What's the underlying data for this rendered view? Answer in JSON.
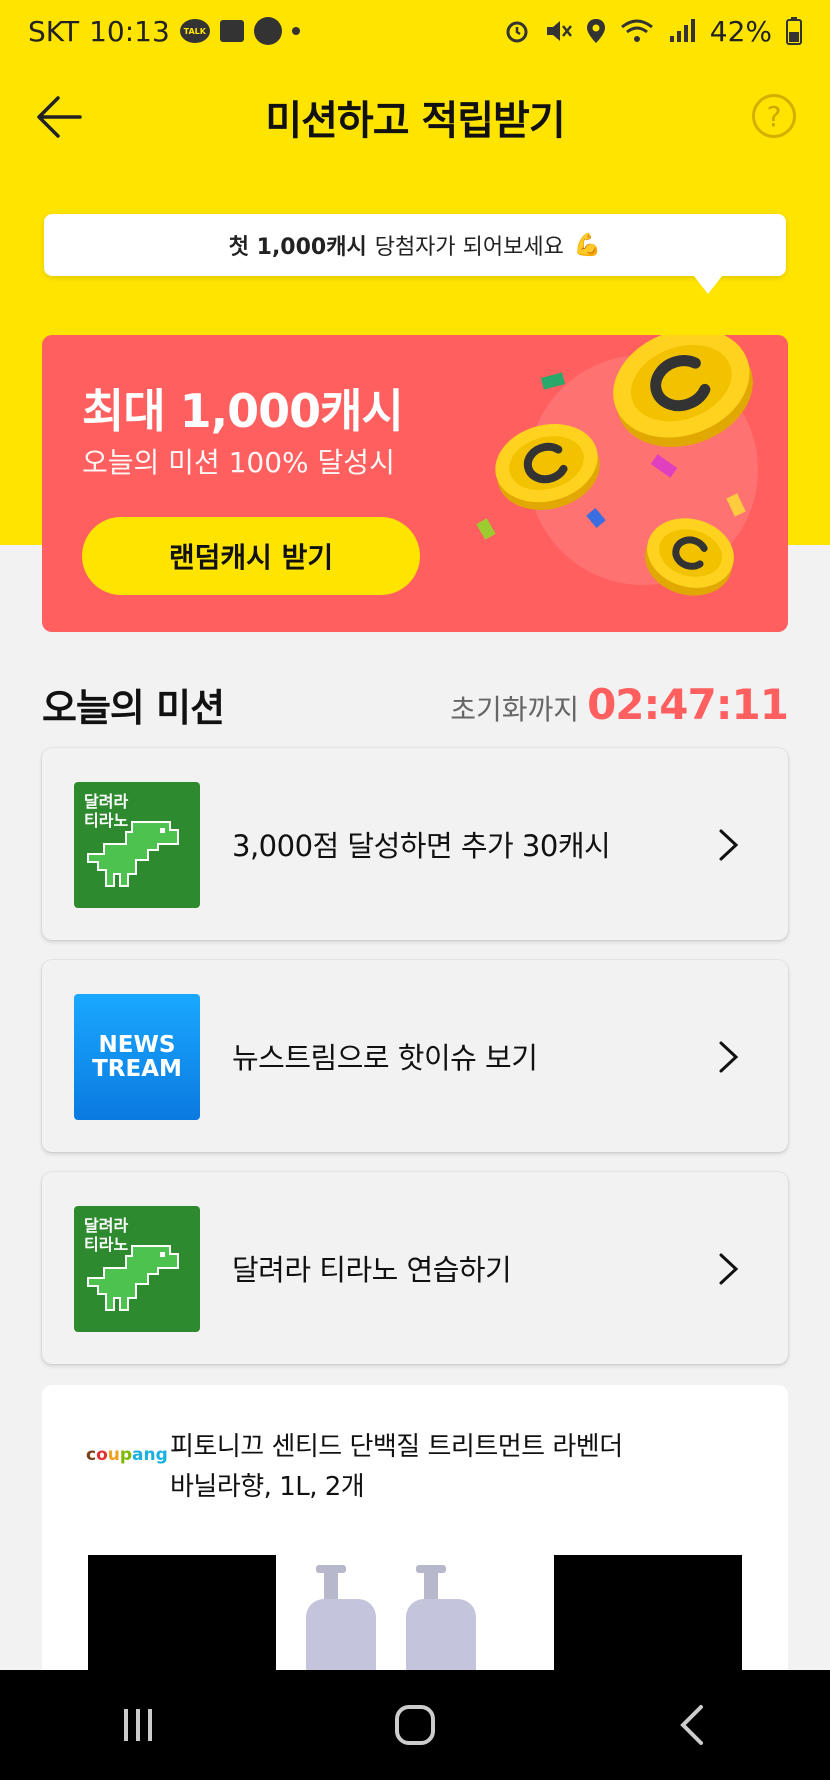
{
  "status_bar": {
    "carrier": "SKT",
    "time": "10:13",
    "talk_label": "TALK",
    "battery_percent": "42%"
  },
  "header": {
    "title": "미션하고 적립받기",
    "help_label": "?"
  },
  "tooltip": {
    "bold": "첫 1,000캐시",
    "rest": "당첨자가 되어보세요",
    "emoji": "💪"
  },
  "promo": {
    "title": "최대 1,000캐시",
    "subtitle": "오늘의 미션 100% 달성시",
    "button_label": "랜덤캐시 받기",
    "bg_color": "#ff5f5f"
  },
  "missions": {
    "title": "오늘의 미션",
    "reset_label": "초기화까지",
    "reset_timer": "02:47:11",
    "items": [
      {
        "thumb": "tirano",
        "thumb_label_1": "달려라",
        "thumb_label_2": "티라노",
        "text": "3,000점 달성하면 추가 30캐시"
      },
      {
        "thumb": "newstream",
        "thumb_label_1": "NEWS",
        "thumb_label_2": "TREAM",
        "text": "뉴스트림으로 핫이슈 보기"
      },
      {
        "thumb": "tirano",
        "thumb_label_1": "달려라",
        "thumb_label_2": "티라노",
        "text": "달려라 티라노 연습하기"
      }
    ]
  },
  "ad": {
    "brand_letters": [
      "c",
      "o",
      "u",
      "p",
      "ang"
    ],
    "title_line1": "피토니끄 센티드 단백질 트리트먼트 라벤더",
    "title_line2": "바닐라향, 1L, 2개"
  },
  "colors": {
    "brand_yellow": "#ffe400",
    "accent_red": "#ff5f5f"
  }
}
